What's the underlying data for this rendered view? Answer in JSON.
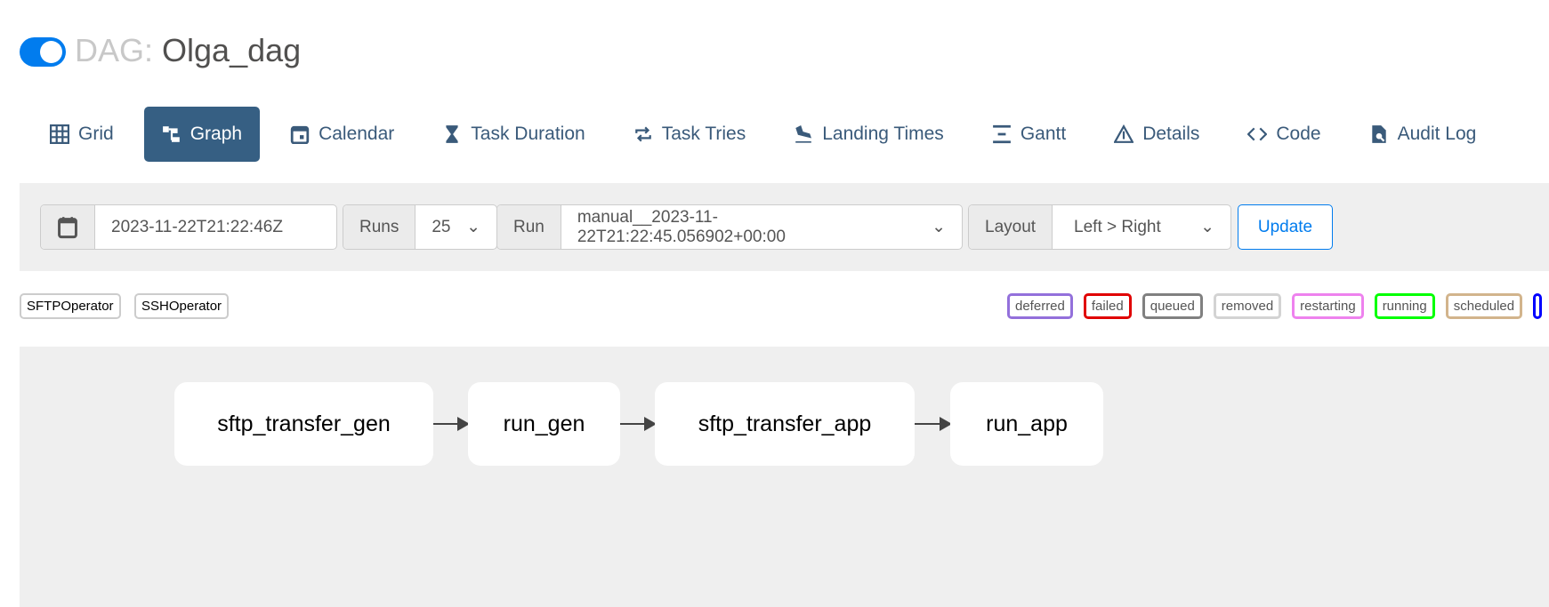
{
  "header": {
    "toggle_on": true,
    "prefix": "DAG:",
    "dag_id": "Olga_dag"
  },
  "tabs": [
    {
      "label": "Grid",
      "icon": "grid-icon"
    },
    {
      "label": "Graph",
      "icon": "graph-icon",
      "active": true
    },
    {
      "label": "Calendar",
      "icon": "calendar-icon"
    },
    {
      "label": "Task Duration",
      "icon": "hourglass-icon"
    },
    {
      "label": "Task Tries",
      "icon": "repeat-icon"
    },
    {
      "label": "Landing Times",
      "icon": "plane-landing-icon"
    },
    {
      "label": "Gantt",
      "icon": "gantt-icon"
    },
    {
      "label": "Details",
      "icon": "warning-triangle-icon"
    },
    {
      "label": "Code",
      "icon": "code-icon"
    },
    {
      "label": "Audit Log",
      "icon": "file-search-icon"
    }
  ],
  "controls": {
    "base_date": "2023-11-22T21:22:46Z",
    "runs_label": "Runs",
    "runs_value": "25",
    "run_label": "Run",
    "run_value": "manual__2023-11-22T21:22:45.056902+00:00",
    "layout_label": "Layout",
    "layout_value": "Left > Right",
    "update_label": "Update"
  },
  "operators": [
    "SFTPOperator",
    "SSHOperator"
  ],
  "states": [
    {
      "label": "deferred",
      "color": "#9370db"
    },
    {
      "label": "failed",
      "color": "#e00000"
    },
    {
      "label": "queued",
      "color": "#808080"
    },
    {
      "label": "removed",
      "color": "#d3d3d3"
    },
    {
      "label": "restarting",
      "color": "#ee82ee"
    },
    {
      "label": "running",
      "color": "#00ff00"
    },
    {
      "label": "scheduled",
      "color": "#d2b48c"
    }
  ],
  "nodes": [
    "sftp_transfer_gen",
    "run_gen",
    "sftp_transfer_app",
    "run_app"
  ]
}
